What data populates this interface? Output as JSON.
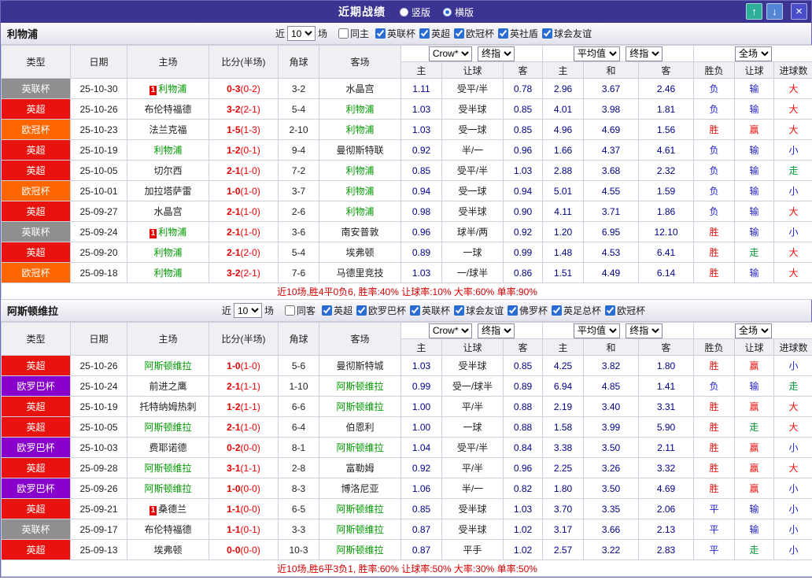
{
  "titlebar": {
    "title": "近期战绩",
    "layout_options": [
      {
        "label": "竖版",
        "selected": false
      },
      {
        "label": "横版",
        "selected": true
      }
    ],
    "up_button": "↑",
    "down_button": "↓",
    "close_button": "×"
  },
  "filters_common": {
    "recent_prefix": "近",
    "recent_suffix": "场"
  },
  "table_header": {
    "type": "类型",
    "date": "日期",
    "home": "主场",
    "score": "比分(半场)",
    "corner": "角球",
    "away": "客场",
    "odds_source": "Crow*",
    "odds_mode": "终指",
    "avg_source": "平均值",
    "avg_mode": "终指",
    "scope": "全场",
    "sub": [
      "主",
      "让球",
      "客",
      "主",
      "和",
      "客",
      "胜负",
      "让球",
      "进球数"
    ]
  },
  "colors": {
    "titlebar_bg": "#3b3492",
    "leagues": {
      "英联杯": "#8f8f8f",
      "英超": "#e8120e",
      "欧冠杯": "#ff6600",
      "欧罗巴杯": "#8800cc"
    },
    "results": {
      "胜": "#e8120e",
      "负": "#2222cc",
      "平": "#2222cc",
      "赢": "#e8120e",
      "输": "#2222cc",
      "走": "#009933",
      "大": "#e8120e",
      "小": "#2222cc"
    },
    "score": "#e60000",
    "focus_team": "#009900",
    "odds": "#00008b",
    "badge": "#e60000"
  },
  "sections": [
    {
      "team": "利物浦",
      "recent_value": "10",
      "venue_filter": {
        "label": "同主",
        "checked": false
      },
      "league_filters": [
        {
          "label": "英联杯",
          "checked": true
        },
        {
          "label": "英超",
          "checked": true
        },
        {
          "label": "欧冠杯",
          "checked": true
        },
        {
          "label": "英社盾",
          "checked": true
        },
        {
          "label": "球会友谊",
          "checked": true
        }
      ],
      "rows": [
        {
          "lg": "英联杯",
          "date": "25-10-30",
          "home": "利物浦",
          "homeFocus": true,
          "homeBadge": "1",
          "ft": "0-3",
          "ht": "(0-2)",
          "corner": "3-2",
          "away": "水晶宫",
          "o1": "1.11",
          "hcap": "受平/半",
          "o2": "0.78",
          "a1": "2.96",
          "a2": "3.67",
          "a3": "2.46",
          "r1": "负",
          "r2": "输",
          "r3": "大"
        },
        {
          "lg": "英超",
          "date": "25-10-26",
          "home": "布伦特福德",
          "ft": "3-2",
          "ht": "(2-1)",
          "corner": "5-4",
          "away": "利物浦",
          "awayFocus": true,
          "o1": "1.03",
          "hcap": "受半球",
          "o2": "0.85",
          "a1": "4.01",
          "a2": "3.98",
          "a3": "1.81",
          "r1": "负",
          "r2": "输",
          "r3": "大"
        },
        {
          "lg": "欧冠杯",
          "date": "25-10-23",
          "home": "法兰克福",
          "ft": "1-5",
          "ht": "(1-3)",
          "corner": "2-10",
          "away": "利物浦",
          "awayFocus": true,
          "o1": "1.03",
          "hcap": "受一球",
          "o2": "0.85",
          "a1": "4.96",
          "a2": "4.69",
          "a3": "1.56",
          "r1": "胜",
          "r2": "赢",
          "r3": "大"
        },
        {
          "lg": "英超",
          "date": "25-10-19",
          "home": "利物浦",
          "homeFocus": true,
          "ft": "1-2",
          "ht": "(0-1)",
          "corner": "9-4",
          "away": "曼彻斯特联",
          "o1": "0.92",
          "hcap": "半/一",
          "o2": "0.96",
          "a1": "1.66",
          "a2": "4.37",
          "a3": "4.61",
          "r1": "负",
          "r2": "输",
          "r3": "小"
        },
        {
          "lg": "英超",
          "date": "25-10-05",
          "home": "切尔西",
          "ft": "2-1",
          "ht": "(1-0)",
          "corner": "7-2",
          "away": "利物浦",
          "awayFocus": true,
          "o1": "0.85",
          "hcap": "受平/半",
          "o2": "1.03",
          "a1": "2.88",
          "a2": "3.68",
          "a3": "2.32",
          "r1": "负",
          "r2": "输",
          "r3": "走"
        },
        {
          "lg": "欧冠杯",
          "date": "25-10-01",
          "home": "加拉塔萨雷",
          "ft": "1-0",
          "ht": "(1-0)",
          "corner": "3-7",
          "away": "利物浦",
          "awayFocus": true,
          "o1": "0.94",
          "hcap": "受一球",
          "o2": "0.94",
          "a1": "5.01",
          "a2": "4.55",
          "a3": "1.59",
          "r1": "负",
          "r2": "输",
          "r3": "小"
        },
        {
          "lg": "英超",
          "date": "25-09-27",
          "home": "水晶宫",
          "ft": "2-1",
          "ht": "(1-0)",
          "corner": "2-6",
          "away": "利物浦",
          "awayFocus": true,
          "o1": "0.98",
          "hcap": "受半球",
          "o2": "0.90",
          "a1": "4.11",
          "a2": "3.71",
          "a3": "1.86",
          "r1": "负",
          "r2": "输",
          "r3": "大"
        },
        {
          "lg": "英联杯",
          "date": "25-09-24",
          "home": "利物浦",
          "homeFocus": true,
          "homeBadge": "1",
          "ft": "2-1",
          "ht": "(1-0)",
          "corner": "3-6",
          "away": "南安普敦",
          "o1": "0.96",
          "hcap": "球半/两",
          "o2": "0.92",
          "a1": "1.20",
          "a2": "6.95",
          "a3": "12.10",
          "r1": "胜",
          "r2": "输",
          "r3": "小"
        },
        {
          "lg": "英超",
          "date": "25-09-20",
          "home": "利物浦",
          "homeFocus": true,
          "ft": "2-1",
          "ht": "(2-0)",
          "corner": "5-4",
          "away": "埃弗顿",
          "o1": "0.89",
          "hcap": "一球",
          "o2": "0.99",
          "a1": "1.48",
          "a2": "4.53",
          "a3": "6.41",
          "r1": "胜",
          "r2": "走",
          "r3": "大"
        },
        {
          "lg": "欧冠杯",
          "date": "25-09-18",
          "home": "利物浦",
          "homeFocus": true,
          "ft": "3-2",
          "ht": "(2-1)",
          "corner": "7-6",
          "away": "马德里竞技",
          "o1": "1.03",
          "hcap": "一/球半",
          "o2": "0.86",
          "a1": "1.51",
          "a2": "4.49",
          "a3": "6.14",
          "r1": "胜",
          "r2": "输",
          "r3": "大"
        }
      ],
      "summary": "近10场,胜4平0负6, 胜率:40% 让球率:10% 大率:60% 单率:90%"
    },
    {
      "team": "阿斯顿维拉",
      "recent_value": "10",
      "venue_filter": {
        "label": "同客",
        "checked": false
      },
      "league_filters": [
        {
          "label": "英超",
          "checked": true
        },
        {
          "label": "欧罗巴杯",
          "checked": true
        },
        {
          "label": "英联杯",
          "checked": true
        },
        {
          "label": "球会友谊",
          "checked": true
        },
        {
          "label": "佛罗杯",
          "checked": true
        },
        {
          "label": "英足总杯",
          "checked": true
        },
        {
          "label": "欧冠杯",
          "checked": true
        }
      ],
      "rows": [
        {
          "lg": "英超",
          "date": "25-10-26",
          "home": "阿斯顿维拉",
          "homeFocus": true,
          "ft": "1-0",
          "ht": "(1-0)",
          "corner": "5-6",
          "away": "曼彻斯特城",
          "o1": "1.03",
          "hcap": "受半球",
          "o2": "0.85",
          "a1": "4.25",
          "a2": "3.82",
          "a3": "1.80",
          "r1": "胜",
          "r2": "赢",
          "r3": "小"
        },
        {
          "lg": "欧罗巴杯",
          "date": "25-10-24",
          "home": "前进之鹰",
          "ft": "2-1",
          "ht": "(1-1)",
          "corner": "1-10",
          "away": "阿斯顿维拉",
          "awayFocus": true,
          "o1": "0.99",
          "hcap": "受一/球半",
          "o2": "0.89",
          "a1": "6.94",
          "a2": "4.85",
          "a3": "1.41",
          "r1": "负",
          "r2": "输",
          "r3": "走"
        },
        {
          "lg": "英超",
          "date": "25-10-19",
          "home": "托特纳姆热刺",
          "ft": "1-2",
          "ht": "(1-1)",
          "corner": "6-6",
          "away": "阿斯顿维拉",
          "awayFocus": true,
          "o1": "1.00",
          "hcap": "平/半",
          "o2": "0.88",
          "a1": "2.19",
          "a2": "3.40",
          "a3": "3.31",
          "r1": "胜",
          "r2": "赢",
          "r3": "大"
        },
        {
          "lg": "英超",
          "date": "25-10-05",
          "home": "阿斯顿维拉",
          "homeFocus": true,
          "ft": "2-1",
          "ht": "(1-0)",
          "corner": "6-4",
          "away": "伯恩利",
          "o1": "1.00",
          "hcap": "一球",
          "o2": "0.88",
          "a1": "1.58",
          "a2": "3.99",
          "a3": "5.90",
          "r1": "胜",
          "r2": "走",
          "r3": "大"
        },
        {
          "lg": "欧罗巴杯",
          "date": "25-10-03",
          "home": "费耶诺德",
          "ft": "0-2",
          "ht": "(0-0)",
          "corner": "8-1",
          "away": "阿斯顿维拉",
          "awayFocus": true,
          "o1": "1.04",
          "hcap": "受平/半",
          "o2": "0.84",
          "a1": "3.38",
          "a2": "3.50",
          "a3": "2.11",
          "r1": "胜",
          "r2": "赢",
          "r3": "小"
        },
        {
          "lg": "英超",
          "date": "25-09-28",
          "home": "阿斯顿维拉",
          "homeFocus": true,
          "ft": "3-1",
          "ht": "(1-1)",
          "corner": "2-8",
          "away": "富勒姆",
          "o1": "0.92",
          "hcap": "平/半",
          "o2": "0.96",
          "a1": "2.25",
          "a2": "3.26",
          "a3": "3.32",
          "r1": "胜",
          "r2": "赢",
          "r3": "大"
        },
        {
          "lg": "欧罗巴杯",
          "date": "25-09-26",
          "home": "阿斯顿维拉",
          "homeFocus": true,
          "ft": "1-0",
          "ht": "(0-0)",
          "corner": "8-3",
          "away": "博洛尼亚",
          "o1": "1.06",
          "hcap": "半/一",
          "o2": "0.82",
          "a1": "1.80",
          "a2": "3.50",
          "a3": "4.69",
          "r1": "胜",
          "r2": "赢",
          "r3": "小"
        },
        {
          "lg": "英超",
          "date": "25-09-21",
          "home": "桑德兰",
          "homeBadge": "1",
          "ft": "1-1",
          "ht": "(0-0)",
          "corner": "6-5",
          "away": "阿斯顿维拉",
          "awayFocus": true,
          "o1": "0.85",
          "hcap": "受半球",
          "o2": "1.03",
          "a1": "3.70",
          "a2": "3.35",
          "a3": "2.06",
          "r1": "平",
          "r2": "输",
          "r3": "小"
        },
        {
          "lg": "英联杯",
          "date": "25-09-17",
          "home": "布伦特福德",
          "ft": "1-1",
          "ht": "(0-1)",
          "corner": "3-3",
          "away": "阿斯顿维拉",
          "awayFocus": true,
          "o1": "0.87",
          "hcap": "受半球",
          "o2": "1.02",
          "a1": "3.17",
          "a2": "3.66",
          "a3": "2.13",
          "r1": "平",
          "r2": "输",
          "r3": "小"
        },
        {
          "lg": "英超",
          "date": "25-09-13",
          "home": "埃弗顿",
          "ft": "0-0",
          "ht": "(0-0)",
          "corner": "10-3",
          "away": "阿斯顿维拉",
          "awayFocus": true,
          "o1": "0.87",
          "hcap": "平手",
          "o2": "1.02",
          "a1": "2.57",
          "a2": "3.22",
          "a3": "2.83",
          "r1": "平",
          "r2": "走",
          "r3": "小"
        }
      ],
      "summary": "近10场,胜6平3负1, 胜率:60% 让球率:50% 大率:30% 单率:50%"
    }
  ]
}
